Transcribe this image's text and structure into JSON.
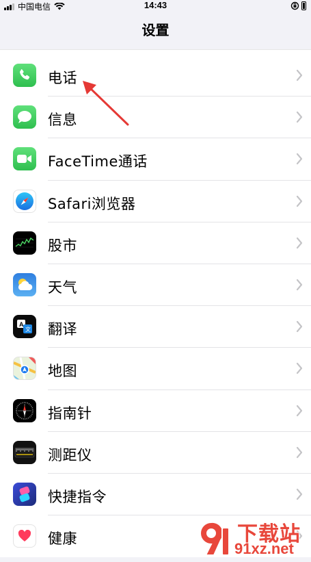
{
  "status_bar": {
    "carrier": "中国电信",
    "time": "14:43"
  },
  "nav": {
    "title": "设置"
  },
  "items": [
    {
      "label": "电话",
      "icon": "phone-icon",
      "color": "#34c759"
    },
    {
      "label": "信息",
      "icon": "messages-icon",
      "color": "#34c759"
    },
    {
      "label": "FaceTime通话",
      "icon": "facetime-icon",
      "color": "#34c759"
    },
    {
      "label": "Safari浏览器",
      "icon": "safari-icon",
      "color": "#1e88e5"
    },
    {
      "label": "股市",
      "icon": "stocks-icon",
      "color": "#000000"
    },
    {
      "label": "天气",
      "icon": "weather-icon",
      "color": "#3b8fe3"
    },
    {
      "label": "翻译",
      "icon": "translate-icon",
      "color": "#000000"
    },
    {
      "label": "地图",
      "icon": "maps-icon",
      "color": "#5fc05f"
    },
    {
      "label": "指南针",
      "icon": "compass-icon",
      "color": "#000000"
    },
    {
      "label": "测距仪",
      "icon": "measure-icon",
      "color": "#000000"
    },
    {
      "label": "快捷指令",
      "icon": "shortcuts-icon",
      "color": "#5a4fcf"
    },
    {
      "label": "健康",
      "icon": "health-icon",
      "color": "#ffffff"
    }
  ],
  "watermark": {
    "line1": "下载站",
    "line2": "91xz.net",
    "brand_color": "#e8473b"
  },
  "annotation": {
    "arrow_color": "#e53935"
  }
}
